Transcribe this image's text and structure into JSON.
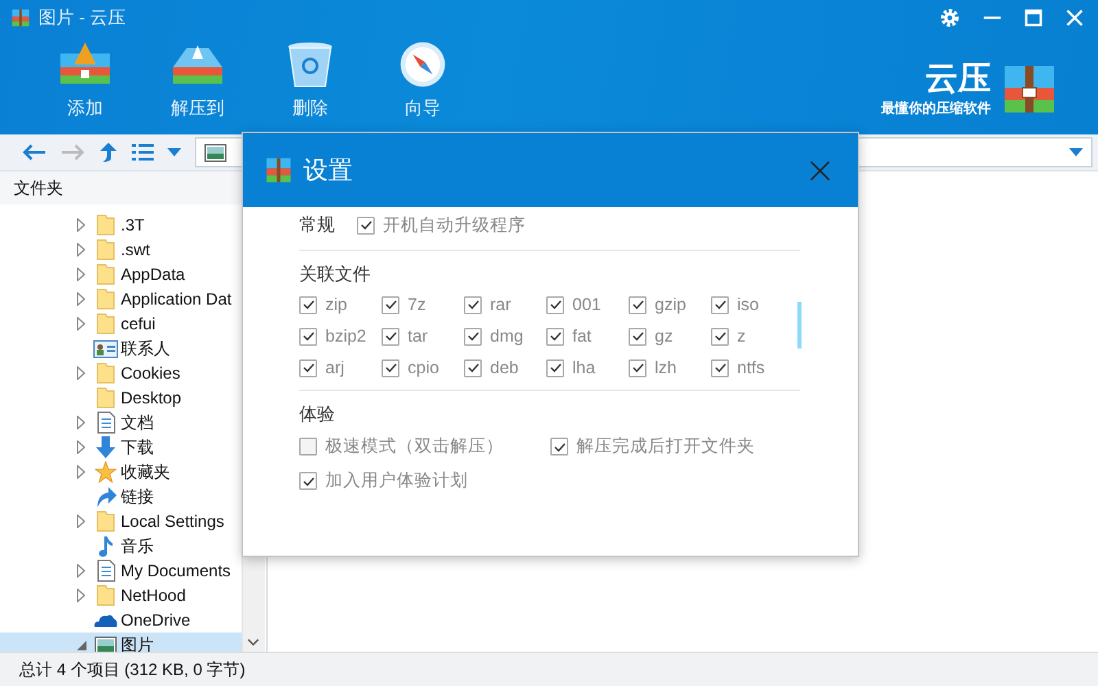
{
  "window": {
    "title": "图片 - 云压"
  },
  "toolbar": [
    {
      "label": "添加",
      "kind": "add"
    },
    {
      "label": "解压到",
      "kind": "extract"
    },
    {
      "label": "删除",
      "kind": "delete"
    },
    {
      "label": "向导",
      "kind": "wizard"
    }
  ],
  "brand": {
    "name": "云压",
    "slogan": "最懂你的压缩软件"
  },
  "nav": {
    "back": {
      "disabled": false
    },
    "forward": {
      "disabled": true
    }
  },
  "folder_pane": {
    "title": "文件夹",
    "items": [
      {
        "label": ".3T",
        "kind": "folder",
        "expanded": false,
        "selected": false
      },
      {
        "label": ".swt",
        "kind": "folder",
        "expanded": false,
        "selected": false
      },
      {
        "label": "AppData",
        "kind": "folder",
        "expanded": false,
        "selected": false
      },
      {
        "label": "Application Dat",
        "kind": "folder",
        "expanded": false,
        "selected": false
      },
      {
        "label": "cefui",
        "kind": "folder",
        "expanded": false,
        "selected": false
      },
      {
        "label": "联系人",
        "kind": "contact",
        "selected": false
      },
      {
        "label": "Cookies",
        "kind": "folder",
        "expanded": false,
        "selected": false
      },
      {
        "label": "Desktop",
        "kind": "folder",
        "selected": false
      },
      {
        "label": "文档",
        "kind": "document",
        "expanded": false,
        "selected": false
      },
      {
        "label": "下载",
        "kind": "download",
        "expanded": false,
        "selected": false
      },
      {
        "label": "收藏夹",
        "kind": "star",
        "expanded": false,
        "selected": false
      },
      {
        "label": "链接",
        "kind": "link",
        "selected": false
      },
      {
        "label": "Local Settings",
        "kind": "folder",
        "expanded": false,
        "selected": false
      },
      {
        "label": "音乐",
        "kind": "music",
        "selected": false
      },
      {
        "label": "My Documents",
        "kind": "document",
        "expanded": false,
        "selected": false
      },
      {
        "label": "NetHood",
        "kind": "folder",
        "expanded": false,
        "selected": false
      },
      {
        "label": "OneDrive",
        "kind": "cloud",
        "selected": false
      },
      {
        "label": "图片",
        "kind": "picture",
        "expanded": true,
        "selected": true
      }
    ]
  },
  "status_bar": "总计 4 个项目 (312 KB, 0 字节)",
  "dialog": {
    "title": "设置",
    "sections": [
      {
        "title": "常规",
        "kind": "inline",
        "options": [
          {
            "label": "开机自动升级程序",
            "checked": true
          }
        ]
      },
      {
        "title": "关联文件",
        "kind": "grid",
        "options": [
          {
            "label": "zip",
            "checked": true
          },
          {
            "label": "7z",
            "checked": true
          },
          {
            "label": "rar",
            "checked": true
          },
          {
            "label": "001",
            "checked": true
          },
          {
            "label": "gzip",
            "checked": true
          },
          {
            "label": "iso",
            "checked": true
          },
          {
            "label": "bzip2",
            "checked": true
          },
          {
            "label": "tar",
            "checked": true
          },
          {
            "label": "dmg",
            "checked": true
          },
          {
            "label": "fat",
            "checked": true
          },
          {
            "label": "gz",
            "checked": true
          },
          {
            "label": "z",
            "checked": true
          },
          {
            "label": "arj",
            "checked": true
          },
          {
            "label": "cpio",
            "checked": true
          },
          {
            "label": "deb",
            "checked": true
          },
          {
            "label": "lha",
            "checked": true
          },
          {
            "label": "lzh",
            "checked": true
          },
          {
            "label": "ntfs",
            "checked": true
          }
        ]
      },
      {
        "title": "体验",
        "kind": "columns",
        "options": [
          {
            "label": "极速模式（双击解压）",
            "checked": false
          },
          {
            "label": "解压完成后打开文件夹",
            "checked": true
          },
          {
            "label": "加入用户体验计划",
            "checked": true
          }
        ]
      }
    ]
  }
}
